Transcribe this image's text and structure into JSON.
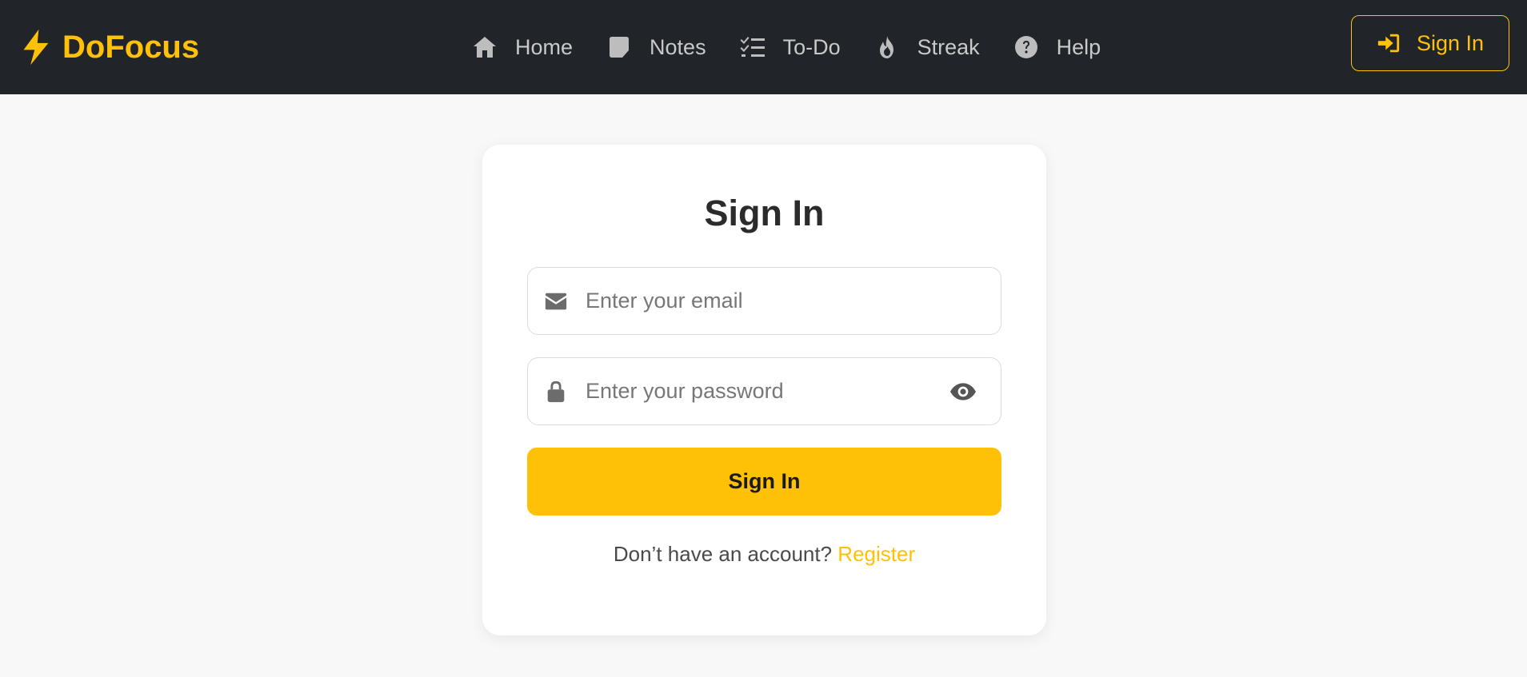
{
  "brand": {
    "name": "DoFocus",
    "icon": "bolt-icon",
    "color": "#ffc107"
  },
  "nav": [
    {
      "label": "Home",
      "icon": "home-icon"
    },
    {
      "label": "Notes",
      "icon": "note-icon"
    },
    {
      "label": "To-Do",
      "icon": "list-check-icon"
    },
    {
      "label": "Streak",
      "icon": "fire-icon"
    },
    {
      "label": "Help",
      "icon": "question-circle-icon"
    }
  ],
  "nav_signin": {
    "label": "Sign In",
    "icon": "sign-in-icon"
  },
  "form": {
    "title": "Sign In",
    "email_placeholder": "Enter your email",
    "password_placeholder": "Enter your password",
    "submit_label": "Sign In",
    "footer_text": "Don’t have an account?",
    "register_label": "Register"
  },
  "colors": {
    "navbar": "#212529",
    "accent": "#ffc107",
    "background": "#f8f8f8"
  }
}
